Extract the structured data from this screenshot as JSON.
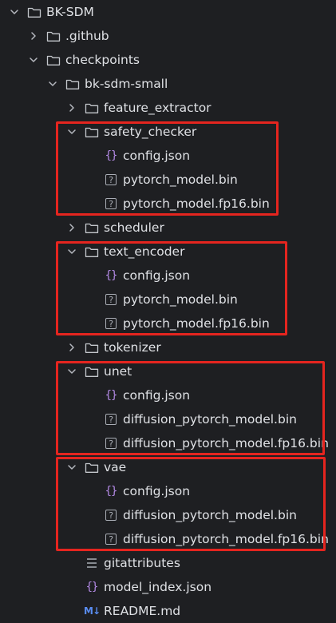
{
  "tree": [
    {
      "label": "BK-SDM",
      "type": "folder",
      "expanded": true,
      "depth": 0
    },
    {
      "label": ".github",
      "type": "folder",
      "expanded": false,
      "depth": 1
    },
    {
      "label": "checkpoints",
      "type": "folder",
      "expanded": true,
      "depth": 1
    },
    {
      "label": "bk-sdm-small",
      "type": "folder",
      "expanded": true,
      "depth": 2
    },
    {
      "label": "feature_extractor",
      "type": "folder",
      "expanded": false,
      "depth": 3
    },
    {
      "label": "safety_checker",
      "type": "folder",
      "expanded": true,
      "depth": 3
    },
    {
      "label": "config.json",
      "type": "json",
      "depth": 4
    },
    {
      "label": "pytorch_model.bin",
      "type": "unknown",
      "depth": 4
    },
    {
      "label": "pytorch_model.fp16.bin",
      "type": "unknown",
      "depth": 4
    },
    {
      "label": "scheduler",
      "type": "folder",
      "expanded": false,
      "depth": 3
    },
    {
      "label": "text_encoder",
      "type": "folder",
      "expanded": true,
      "depth": 3
    },
    {
      "label": "config.json",
      "type": "json",
      "depth": 4
    },
    {
      "label": "pytorch_model.bin",
      "type": "unknown",
      "depth": 4
    },
    {
      "label": "pytorch_model.fp16.bin",
      "type": "unknown",
      "depth": 4
    },
    {
      "label": "tokenizer",
      "type": "folder",
      "expanded": false,
      "depth": 3
    },
    {
      "label": "unet",
      "type": "folder",
      "expanded": true,
      "depth": 3
    },
    {
      "label": "config.json",
      "type": "json",
      "depth": 4
    },
    {
      "label": "diffusion_pytorch_model.bin",
      "type": "unknown",
      "depth": 4
    },
    {
      "label": "diffusion_pytorch_model.fp16.bin",
      "type": "unknown",
      "depth": 4
    },
    {
      "label": "vae",
      "type": "folder",
      "expanded": true,
      "depth": 3
    },
    {
      "label": "config.json",
      "type": "json",
      "depth": 4
    },
    {
      "label": "diffusion_pytorch_model.bin",
      "type": "unknown",
      "depth": 4
    },
    {
      "label": "diffusion_pytorch_model.fp16.bin",
      "type": "unknown",
      "depth": 4
    },
    {
      "label": "gitattributes",
      "type": "text",
      "depth": 3
    },
    {
      "label": "model_index.json",
      "type": "json",
      "depth": 3
    },
    {
      "label": "README.md",
      "type": "markdown",
      "depth": 3
    }
  ],
  "highlights": [
    {
      "folder": "safety_checker"
    },
    {
      "folder": "text_encoder"
    },
    {
      "folder": "unet"
    },
    {
      "folder": "vae"
    }
  ],
  "colors": {
    "background": "#1e1f22",
    "text": "#dfe1e5",
    "highlight": "#e5251f",
    "json_icon": "#b48ae6",
    "md_icon": "#5a8df2",
    "icon_grey": "#a9adb5"
  },
  "icons": {
    "folder": "folder-icon",
    "json": "json-file-icon",
    "unknown": "unknown-file-icon",
    "text": "text-file-icon",
    "markdown": "markdown-file-icon",
    "expanded": "chevron-down-icon",
    "collapsed": "chevron-right-icon"
  },
  "glyphs": {
    "json": "{}",
    "unknown": "?",
    "markdown": "M↓"
  }
}
